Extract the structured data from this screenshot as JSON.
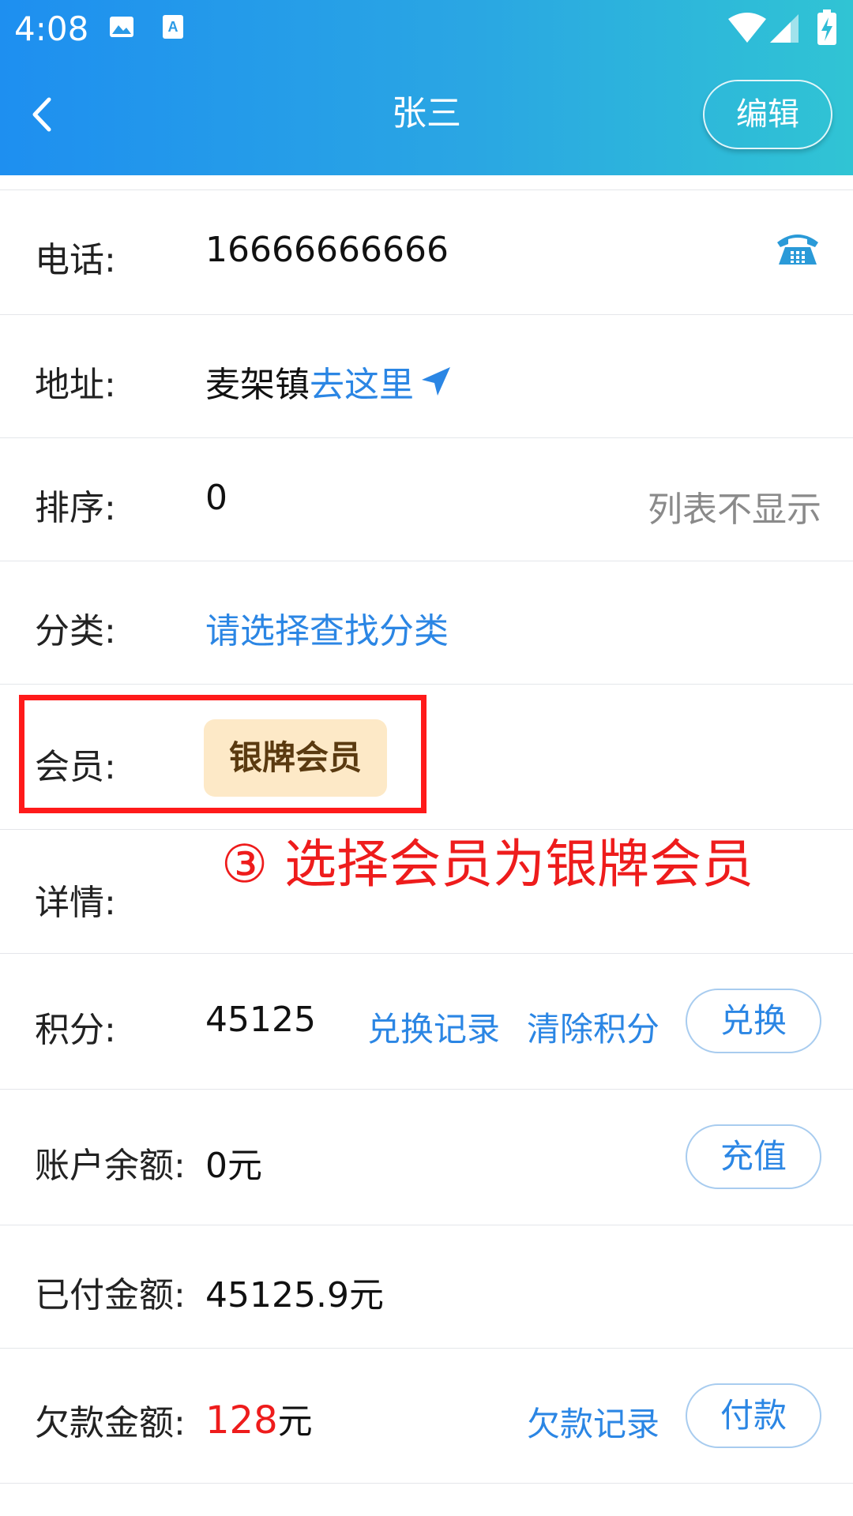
{
  "status_bar": {
    "time": "4:08",
    "icons": [
      "image-icon",
      "font-icon",
      "wifi-icon",
      "signal-icon",
      "battery-icon"
    ]
  },
  "header": {
    "title": "张三",
    "edit_label": "编辑"
  },
  "rows": {
    "phone": {
      "label": "电话:",
      "value": "16666666666"
    },
    "address": {
      "label": "地址:",
      "value": "麦架镇",
      "link": "去这里"
    },
    "sort": {
      "label": "排序:",
      "value": "0",
      "hint": "列表不显示"
    },
    "category": {
      "label": "分类:",
      "placeholder": "请选择查找分类"
    },
    "member": {
      "label": "会员:",
      "badge": "银牌会员"
    },
    "detail": {
      "label": "详情:"
    },
    "points": {
      "label": "积分:",
      "value": "45125",
      "link1": "兑换记录",
      "link2": "清除积分",
      "button": "兑换"
    },
    "balance": {
      "label": "账户余额:",
      "value": "0元",
      "button": "充值"
    },
    "paid": {
      "label": "已付金额:",
      "value": "45125.9元"
    },
    "debt": {
      "label": "欠款金额:",
      "amount": "128",
      "unit": "元",
      "link": "欠款记录",
      "button": "付款"
    }
  },
  "annotation": {
    "text": "③ 选择会员为银牌会员"
  },
  "colors": {
    "header_start": "#1e8ff0",
    "header_end": "#30c4d4",
    "link_blue": "#2b86e4",
    "alert_red": "#ee1c1c",
    "badge_bg": "#fde9c7"
  }
}
